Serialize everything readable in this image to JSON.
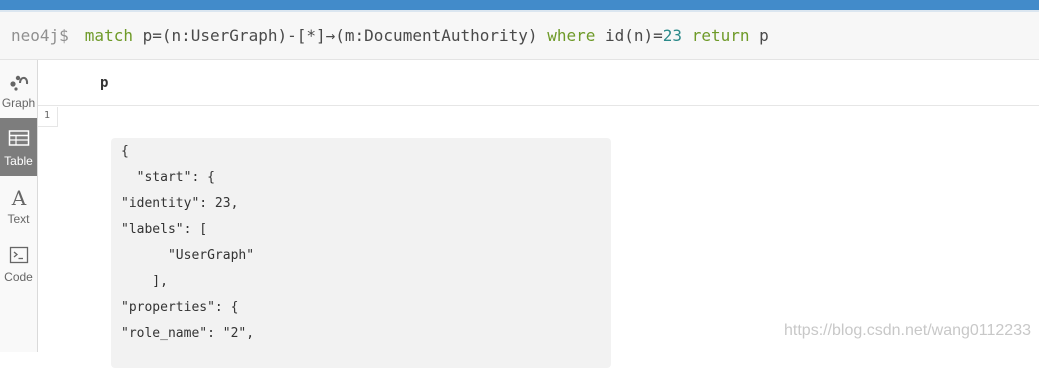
{
  "query": {
    "prompt": "neo4j$",
    "tokens": [
      {
        "text": "match",
        "kind": "kw"
      },
      {
        "text": " p=(n:UserGraph)-[*]→(m:DocumentAuthority) ",
        "kind": "plain"
      },
      {
        "text": "where",
        "kind": "kw"
      },
      {
        "text": " id(n)=",
        "kind": "plain"
      },
      {
        "text": "23",
        "kind": "num"
      },
      {
        "text": " ",
        "kind": "plain"
      },
      {
        "text": "return",
        "kind": "kw"
      },
      {
        "text": " p",
        "kind": "plain"
      }
    ]
  },
  "sidebar": {
    "items": [
      {
        "label": "Graph",
        "icon": "graph-icon",
        "active": false
      },
      {
        "label": "Table",
        "icon": "table-icon",
        "active": true
      },
      {
        "label": "Text",
        "icon": "text-icon",
        "active": false
      },
      {
        "label": "Code",
        "icon": "code-icon",
        "active": false
      }
    ]
  },
  "table": {
    "column": "p",
    "row_number": "1",
    "json_lines": [
      "{",
      "  \"start\": {",
      "\"identity\": 23,",
      "\"labels\": [",
      "      \"UserGraph\"",
      "    ],",
      "\"properties\": {",
      "\"role_name\": \"2\","
    ]
  },
  "watermark": "https://blog.csdn.net/wang0112233",
  "colors": {
    "accent": "#428bca",
    "keyword": "#6e9a28",
    "number": "#2c8a8a"
  }
}
